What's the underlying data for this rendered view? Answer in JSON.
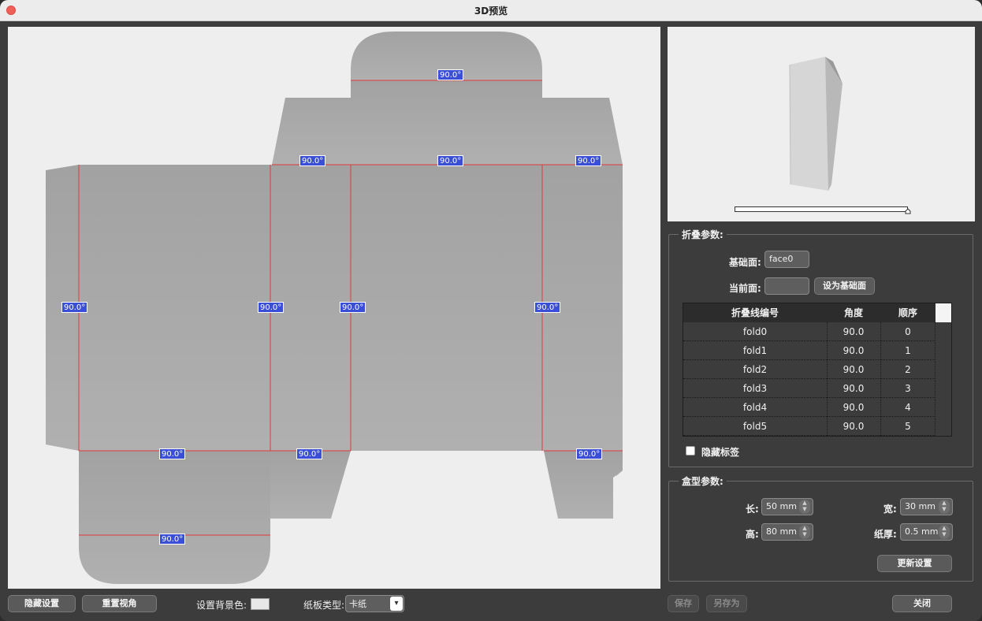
{
  "window": {
    "title": "3D预览"
  },
  "canvas": {
    "fold_labels": [
      "90.0°",
      "90.0°",
      "90.0°",
      "90.0°",
      "90.0°",
      "90.0°",
      "90.0°",
      "90.0°",
      "90.0°",
      "90.0°",
      "90.0°",
      "90.0°",
      "90.0°"
    ]
  },
  "fold_params": {
    "title": "折叠参数:",
    "base_face_label": "基础面:",
    "base_face_value": "face0",
    "current_face_label": "当前面:",
    "current_face_value": "",
    "set_base_button": "设为基础面",
    "table": {
      "headers": [
        "折叠线编号",
        "角度",
        "顺序"
      ],
      "rows": [
        [
          "fold0",
          "90.0",
          "0"
        ],
        [
          "fold1",
          "90.0",
          "1"
        ],
        [
          "fold2",
          "90.0",
          "2"
        ],
        [
          "fold3",
          "90.0",
          "3"
        ],
        [
          "fold4",
          "90.0",
          "4"
        ],
        [
          "fold5",
          "90.0",
          "5"
        ]
      ]
    },
    "hide_labels": "隐藏标签"
  },
  "box_params": {
    "title": "盒型参数:",
    "length_label": "长:",
    "length_value": "50 mm",
    "width_label": "宽:",
    "width_value": "30 mm",
    "height_label": "高:",
    "height_value": "80 mm",
    "thickness_label": "纸厚:",
    "thickness_value": "0.5 mm",
    "update_button": "更新设置"
  },
  "bottom_bar": {
    "hide_settings": "隐藏设置",
    "reset_view": "重置视角",
    "bg_color_label": "设置背景色:",
    "board_type_label": "纸板类型:",
    "board_type_value": "卡纸",
    "save": "保存",
    "save_as": "另存为",
    "close": "关闭"
  },
  "colors": {
    "fold_line": "#e03a3a",
    "label_bg": "#3b4fd6",
    "panel_fill": "#a4a4a4"
  }
}
